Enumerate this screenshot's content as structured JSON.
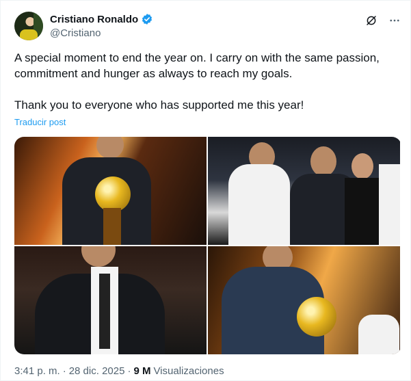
{
  "author": {
    "name": "Cristiano Ronaldo",
    "handle": "@Cristiano"
  },
  "tweet": {
    "paragraph1": "A special moment to end the year on. I carry on with the same passion, commitment and hunger as always to reach my goals.",
    "paragraph2": "Thank you to everyone who has supported me this year!",
    "translate_label": "Traducir post"
  },
  "media": {
    "photos": [
      {
        "icon": "photo-ronaldo-trophy"
      },
      {
        "icon": "photo-ronaldo-audience"
      },
      {
        "icon": "photo-ronaldo-seated"
      },
      {
        "icon": "photo-ronaldo-stage"
      }
    ]
  },
  "meta": {
    "time": "3:41 p. m.",
    "separator1": "·",
    "date": "28 dic. 2025",
    "separator2": "·",
    "views_count": "9 M",
    "views_label": "Visualizaciones"
  },
  "colors": {
    "accent": "#1d9bf0",
    "secondary_text": "#536471",
    "primary_text": "#0f1419"
  }
}
